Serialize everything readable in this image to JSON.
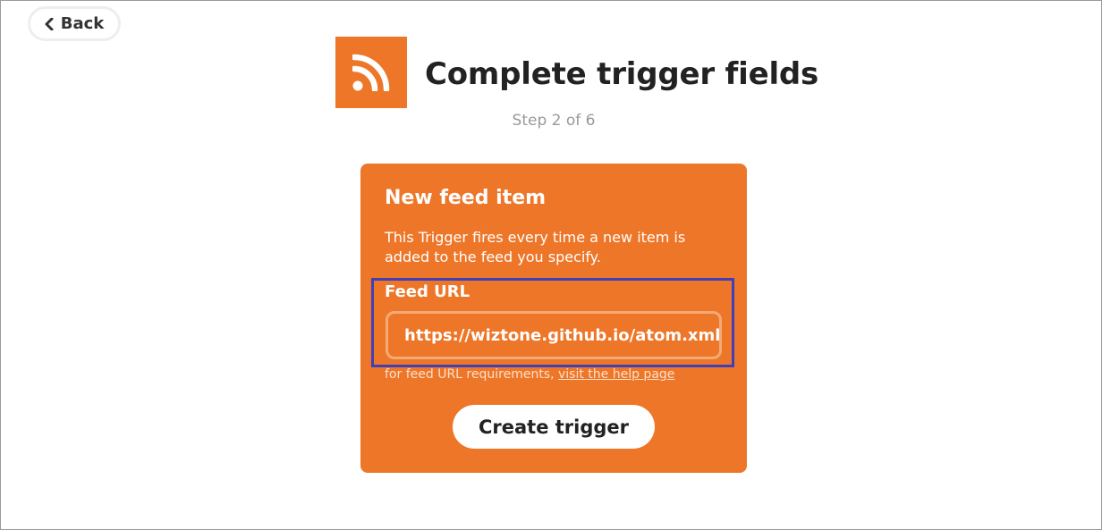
{
  "nav": {
    "back_label": "Back"
  },
  "header": {
    "title": "Complete trigger fields",
    "step": "Step 2 of 6",
    "service_icon": "rss-feed-icon"
  },
  "trigger": {
    "title": "New feed item",
    "description": "This Trigger fires every time a new item is added to the feed you specify.",
    "field_label": "Feed URL",
    "field_value": "https://wiztone.github.io/atom.xml",
    "help_prefix": "for feed URL requirements, ",
    "help_link": "visit the help page",
    "submit_label": "Create trigger"
  },
  "colors": {
    "accent": "#ee7628",
    "highlight_border": "#3f3fb8"
  }
}
